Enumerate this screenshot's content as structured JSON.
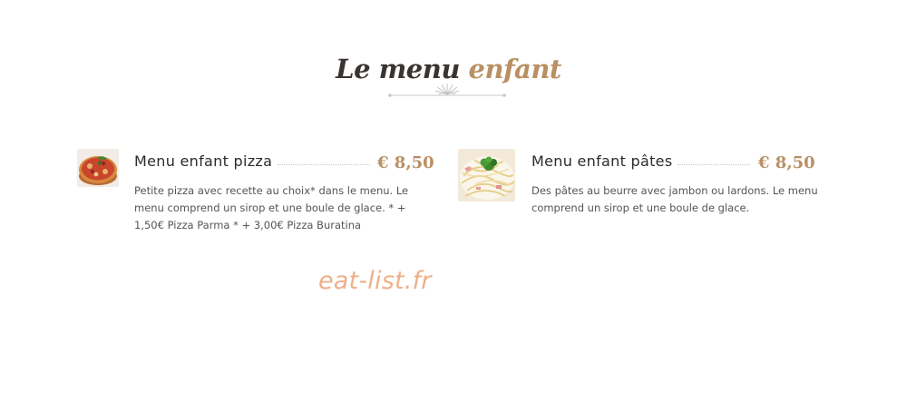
{
  "section": {
    "title_main": "Le menu",
    "title_accent": "enfant"
  },
  "items": [
    {
      "name": "Menu enfant pizza",
      "price": "€ 8,50",
      "description": "Petite pizza avec recette au choix* dans le menu. Le menu comprend un sirop et une boule de glace. * + 1,50€ Pizza Parma * + 3,00€ Pizza Buratina",
      "image": "pizza-photo"
    },
    {
      "name": "Menu enfant pâtes",
      "price": "€ 8,50",
      "description": "Des pâtes au beurre avec jambon ou lardons. Le menu comprend un sirop et une boule de glace.",
      "image": "pasta-photo"
    }
  ],
  "watermark": "eat-list.fr",
  "colors": {
    "accent": "#b98f63",
    "title": "#3a3431",
    "watermark": "#eeb08a"
  }
}
